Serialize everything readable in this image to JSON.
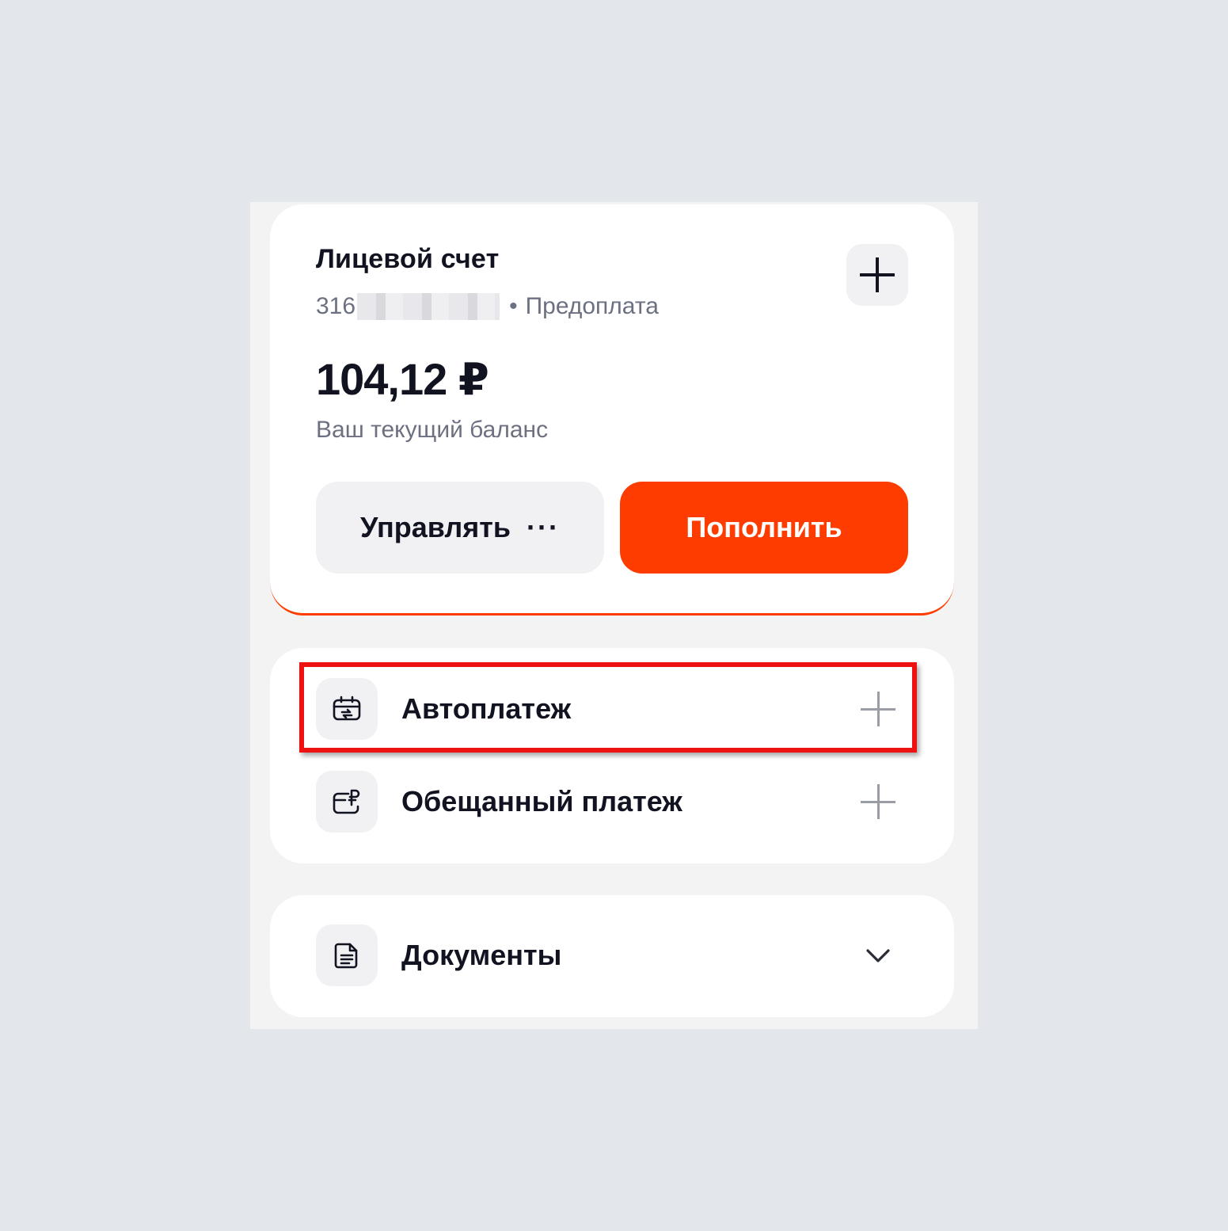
{
  "account": {
    "title": "Лицевой счет",
    "number_prefix": "316",
    "separator": "•",
    "tariff_type": "Предоплата",
    "balance": "104,12 ₽",
    "balance_caption": "Ваш текущий баланс",
    "manage_label": "Управлять",
    "manage_more": "···",
    "topup_label": "Пополнить"
  },
  "payments": {
    "items": [
      {
        "label": "Автоплатеж",
        "icon": "autopay-icon",
        "action_icon": "plus-icon",
        "highlighted": true
      },
      {
        "label": "Обещанный платеж",
        "icon": "promised-payment-icon",
        "action_icon": "plus-icon",
        "highlighted": false
      }
    ]
  },
  "documents": {
    "label": "Документы",
    "icon": "document-icon",
    "action_icon": "chevron-down-icon"
  },
  "colors": {
    "accent": "#ff3c00",
    "highlight_border": "#ee1111",
    "page_background": "#e3e7eb",
    "panel_background": "#f3f3f4",
    "text_primary": "#111320",
    "text_secondary": "#6c7081"
  }
}
